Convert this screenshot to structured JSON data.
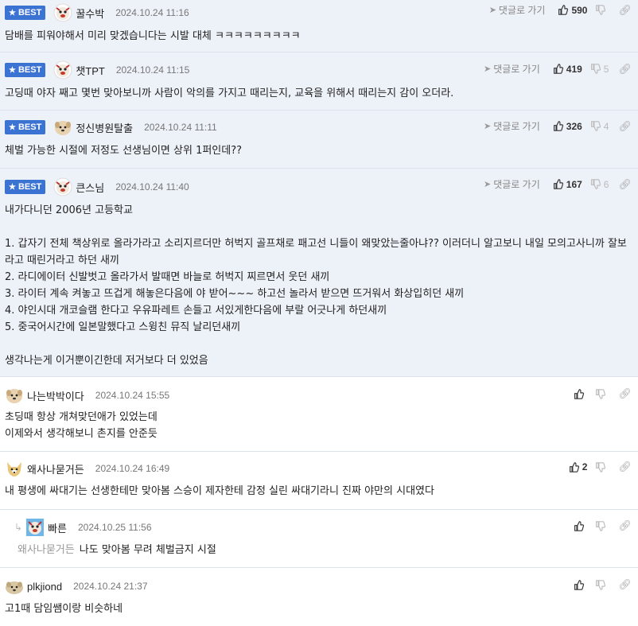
{
  "labels": {
    "best": "BEST",
    "goto": "댓글로 가기"
  },
  "comments": [
    {
      "nick": "꿀수박",
      "date": "2024.10.24 11:16",
      "likes": "590",
      "dislikes": "",
      "text": "담배를 피워야해서 미리 맞겠습니다는 시발 대체 ㅋㅋㅋㅋㅋㅋㅋㅋㅋ"
    },
    {
      "nick": "챗TPT",
      "date": "2024.10.24 11:15",
      "likes": "419",
      "dislikes": "5",
      "text": "고딩때 야자 째고 몇번 맞아보니까 사람이 악의를 가지고 때리는지, 교육을 위해서 때리는지 감이 오더라."
    },
    {
      "nick": "정신병원탈출",
      "date": "2024.10.24 11:11",
      "likes": "326",
      "dislikes": "4",
      "text": "체벌 가능한 시절에 저정도 선생님이면 상위 1퍼인데??"
    },
    {
      "nick": "큰스님",
      "date": "2024.10.24 11:40",
      "likes": "167",
      "dislikes": "6",
      "text": "내가다니던 2006년 고등학교\n\n1. 갑자기 전체 책상위로 올라가라고 소리지르더만 허벅지 골프채로 패고선 니들이 왜맞았는줄아냐?? 이러더니 알고보니 내일 모의고사니까 잘보라고 때린거라고 하던 새끼\n2. 라디에이터 신발벗고 올라가서 발때면 바늘로 허벅지 찌르면서 웃던 새끼\n3. 라이터 계속 켜놓고 뜨겁게 해놓은다음에 야 받어~~~ 하고선 놀라서 받으면 뜨거워서 화상입히던 새끼\n4. 야인시대 개코슬램 한다고 우유파레트 손들고 서있게한다음에 부랄 어긋나게 하던새끼\n5. 중국어시간에 일본말했다고 스윙친 뮤직 날리던새끼\n\n생각나는게 이거뿐이긴한데 저거보다 더 있었음"
    },
    {
      "nick": "나는박박이다",
      "date": "2024.10.24 15:55",
      "likes": "",
      "dislikes": "",
      "text": "초딩때 항상 개쳐맞던애가 있었는데\n이제와서 생각해보니 촌지를 안준듯"
    },
    {
      "nick": "왜사나묻거든",
      "date": "2024.10.24 16:49",
      "likes": "2",
      "dislikes": "",
      "text": "내 평생에 싸대기는 선생한테만 맞아봄 스승이 제자한테 감정 실린 싸대기라니 진짜 야만의 시대였다"
    },
    {
      "nick": "빠른",
      "date": "2024.10.25 11:56",
      "likes": "",
      "dislikes": "",
      "reply_to": "왜사나묻거든",
      "text": "나도 맞아봄 무려 체벌금지 시절"
    },
    {
      "nick": "plkjiond",
      "date": "2024.10.24 21:37",
      "likes": "",
      "dislikes": "",
      "text": "고1때 담임쌤이랑 비슷하네"
    }
  ]
}
